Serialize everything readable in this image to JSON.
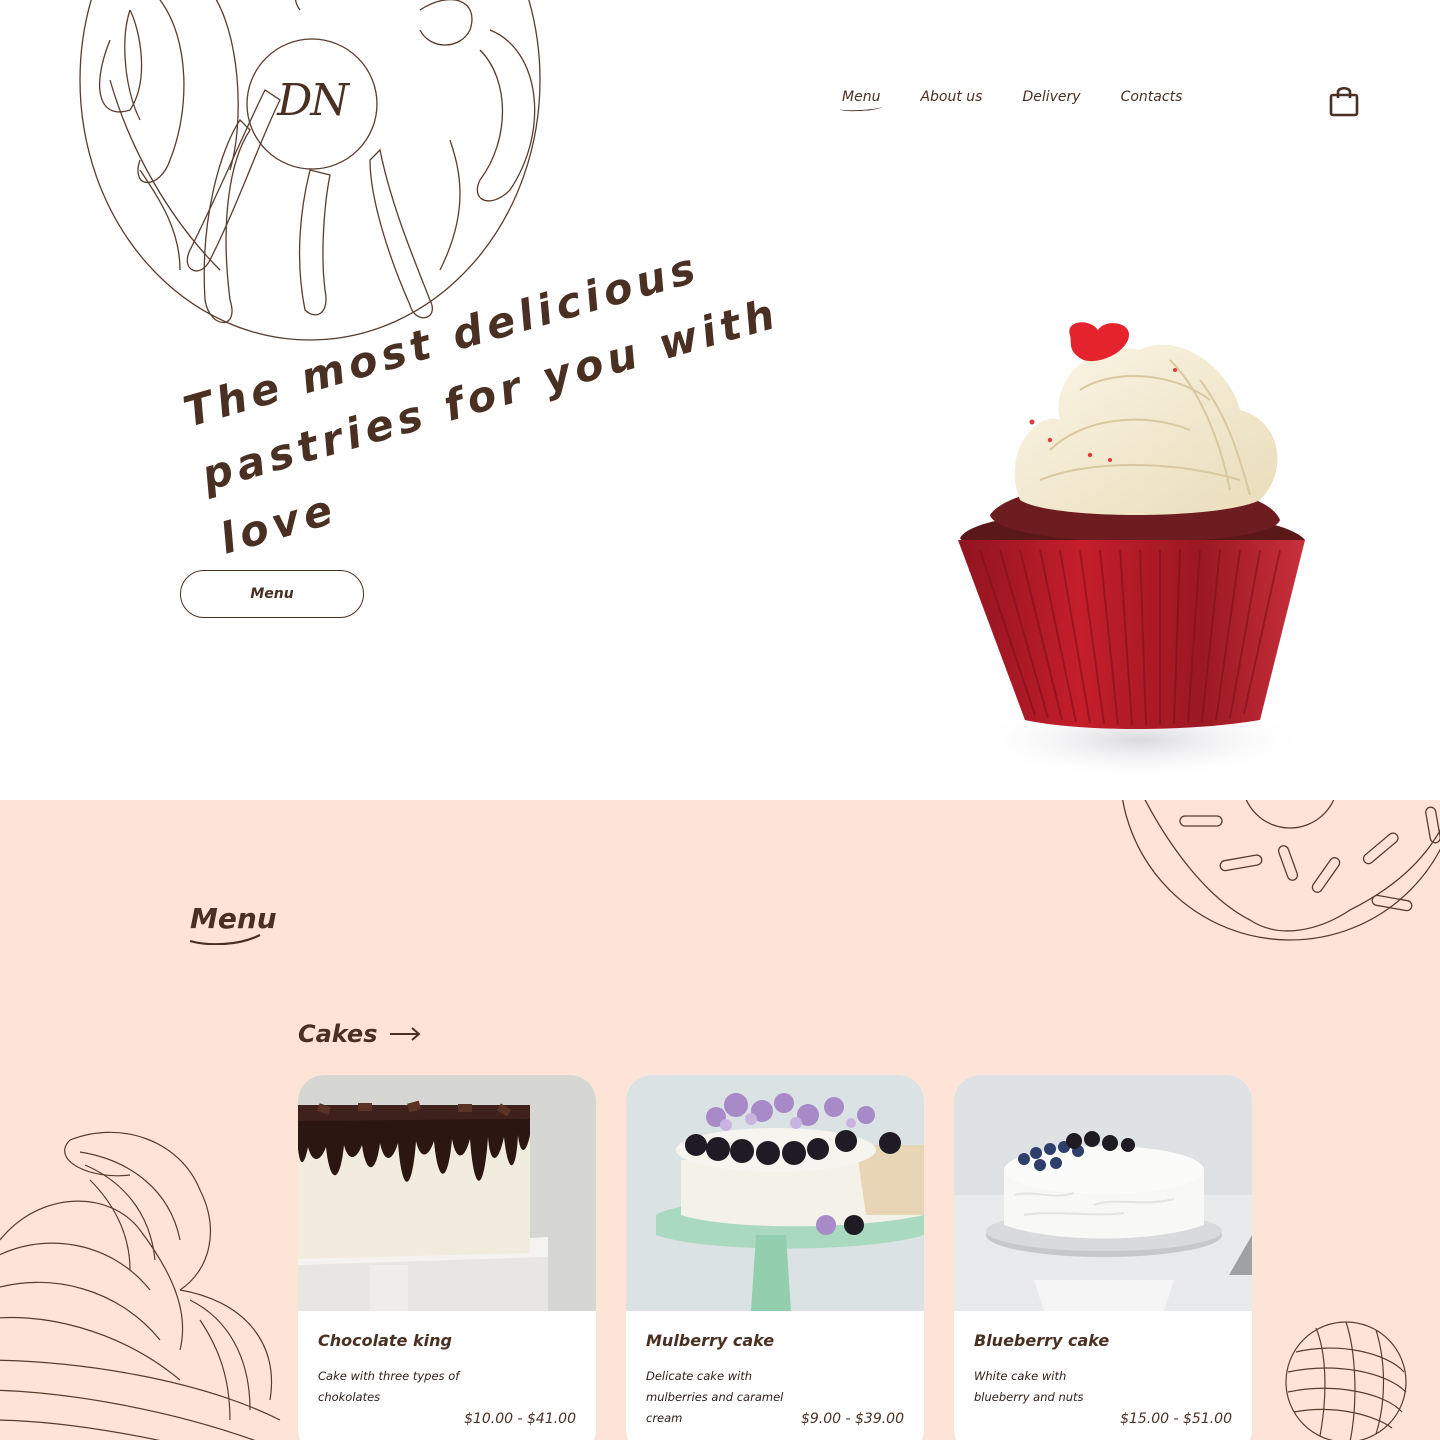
{
  "brand": {
    "logo_letters": "DN"
  },
  "nav": {
    "items": [
      {
        "label": "Menu",
        "active": true
      },
      {
        "label": "About us",
        "active": false
      },
      {
        "label": "Delivery",
        "active": false
      },
      {
        "label": "Contacts",
        "active": false
      }
    ],
    "cart_icon": "shopping-bag-icon"
  },
  "hero": {
    "headline_line1": "The most delicious",
    "headline_line2": "pastries for you with love",
    "button_label": "Menu"
  },
  "menu": {
    "title": "Menu",
    "category": {
      "label": "Cakes",
      "icon": "arrow-right-icon"
    },
    "cards": [
      {
        "name": "Chocolate king",
        "description": "Cake with three types of chokolates",
        "price": "$10.00 - $41.00"
      },
      {
        "name": "Mulberry cake",
        "description": "Delicate cake with mulberries and caramel cream",
        "price": "$9.00 - $39.00"
      },
      {
        "name": "Blueberry cake",
        "description": "White cake with blueberry and nuts",
        "price": "$15.00 - $51.00"
      }
    ]
  },
  "colors": {
    "primary_text": "#4a3023",
    "menu_background": "#fee4d6",
    "card_background": "#ffffff",
    "cupcake_wrapper": "#c41e2a",
    "frosting": "#f6eed6"
  }
}
